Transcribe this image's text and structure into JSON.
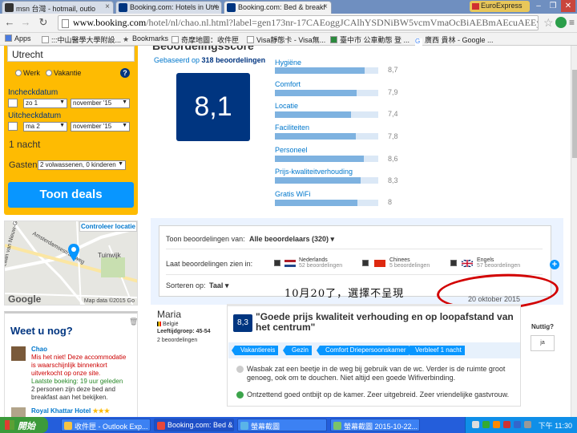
{
  "browser": {
    "tabs": [
      {
        "label": "msn 台灣 - hotmail, outlo",
        "active": false
      },
      {
        "label": "Booking.com: Hotels in Utre",
        "active": false
      },
      {
        "label": "Booking.com: Bed & breakf",
        "active": true
      }
    ],
    "extension_label": "EuroExpress",
    "url_domain": "www.booking.com",
    "url_rest": "/hotel/nl/chao.nl.html?label=gen173nr-17CAEoggJCAlhYSDNiBW5vcmVmaOcBiAEBmAEcuAEEyAEE2AEI",
    "bookmarks": [
      "Apps",
      ":::中山醫學大學附設...",
      "Bookmarks",
      "奇摩地圖：收件匣",
      "Visa靜態卡 - Visa無...",
      "臺中市 公車動態 登 ...",
      "廣西 貴林 - Google ..."
    ]
  },
  "search": {
    "city": "Utrecht",
    "trip_type": [
      "Werk",
      "Vakantie"
    ],
    "checkin_label": "Incheckdatum",
    "checkin_day": "zo 1",
    "checkin_month": "november '15",
    "checkout_label": "Uitcheckdatum",
    "checkout_day": "ma 2",
    "checkout_month": "november '15",
    "nights": "1 nacht",
    "guests_label": "Gasten",
    "guests_value": "2 volwassenen, 0 kinderen",
    "submit_label": "Toon deals"
  },
  "map": {
    "control_label": "Controleer locatie",
    "place_labels": [
      "Tuinwijk",
      "Amsterdamsestraatweg",
      "Laan van Nieuw-Guinea"
    ],
    "google": "Google",
    "map_data": "Map data ©2015 Go"
  },
  "recent": {
    "title": "Weet u nog?",
    "items": [
      {
        "name": "Chao",
        "warning": "Mis het niet! Deze accommodatie is waarschijnlijk binnenkort uitverkocht op onze site.",
        "last_booking": "Laatste boeking: 19 uur geleden",
        "detail": "2 personen zijn deze bed and breakfast aan het bekijken."
      },
      {
        "name": "Royal Khattar Hotel",
        "stars": "★★★"
      }
    ]
  },
  "score": {
    "heading": "Beoordelingsscore",
    "based_prefix": "Gebaseerd op ",
    "based_count": "318 beoordelingen",
    "overall": "8,1",
    "categories": [
      {
        "label": "Hygiëne",
        "value": "8,7",
        "fraction": 0.87
      },
      {
        "label": "Comfort",
        "value": "7,9",
        "fraction": 0.79
      },
      {
        "label": "Locatie",
        "value": "7,4",
        "fraction": 0.74
      },
      {
        "label": "Faciliteiten",
        "value": "7,8",
        "fraction": 0.78
      },
      {
        "label": "Personeel",
        "value": "8,6",
        "fraction": 0.86
      },
      {
        "label": "Prijs-kwaliteitverhouding",
        "value": "8,3",
        "fraction": 0.83
      },
      {
        "label": "Gratis WiFi",
        "value": "8",
        "fraction": 0.8
      }
    ]
  },
  "filters": {
    "show_label": "Toon beoordelingen van:",
    "show_value": "Alle beoordelaars (320)",
    "lang_label": "Laat beoordelingen zien in:",
    "languages": [
      {
        "name": "Nederlands",
        "count": "52 beoordelingen"
      },
      {
        "name": "Chinees",
        "count": "5 beoordelingen"
      },
      {
        "name": "Engels",
        "count": "57 beoordelingen"
      }
    ],
    "sort_label": "Sorteren op:",
    "sort_value": "Taal"
  },
  "annotation": "10月20了，選擇不呈現",
  "review": {
    "date": "20 oktober 2015",
    "name": "Maria",
    "country": "België",
    "age_group": "Leeftijdgroep: 45-54",
    "count": "2 beoordelingen",
    "score": "8,3",
    "title": "\"Goede prijs kwaliteit verhouding en op loopafstand van het centrum\"",
    "tags": [
      "Vakantiereis",
      "Gezin",
      "Comfort Driepersoonskamer",
      "Verbleef 1 nacht"
    ],
    "negative": "Wasbak zat een beetje in de weg bij gebruik van de wc. Verder is de ruimte groot genoeg, ook om te douchen. Niet altijd een goede Wifiverbinding.",
    "positive": "Ontzettend goed ontbijt op de kamer. Zeer uitgebreid. Zeer vriendelijke gastvrouw.",
    "helpful_label": "Nuttig?",
    "yes_label": "ja"
  },
  "taskbar": {
    "start": "開始",
    "items": [
      "收件匣 - Outlook Exp...",
      "Booking.com: Bed &...",
      "螢幕截圖",
      "螢幕截圖 2015-10-22..."
    ],
    "clock": "下午 11:30"
  }
}
